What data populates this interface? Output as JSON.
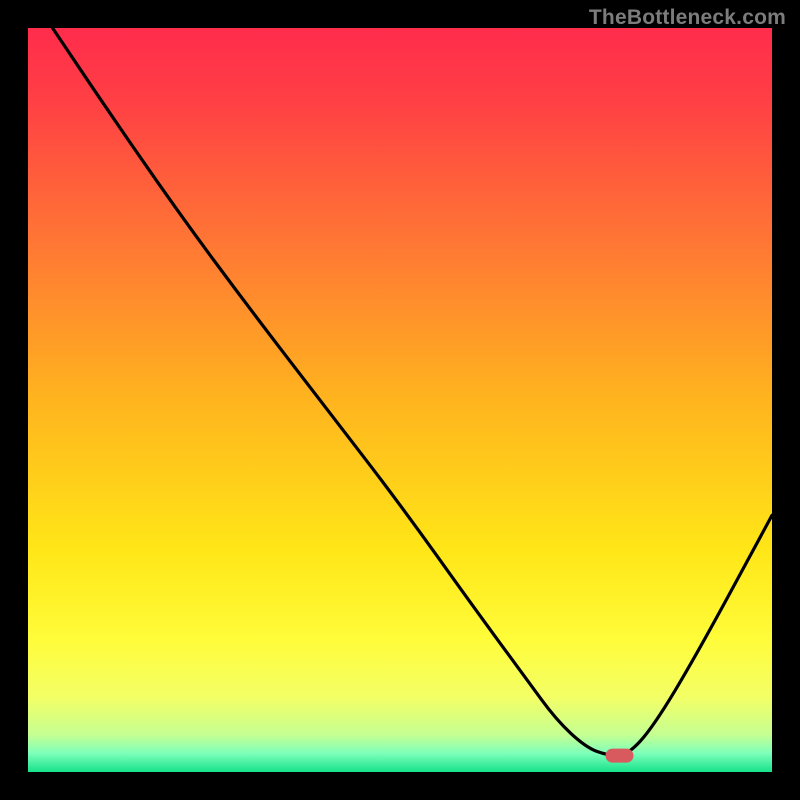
{
  "watermark": "TheBottleneck.com",
  "chart_data": {
    "type": "line",
    "title": "",
    "xlabel": "",
    "ylabel": "",
    "xlim": [
      0,
      100
    ],
    "ylim": [
      0,
      100
    ],
    "series": [
      {
        "name": "curve",
        "x": [
          3.3,
          10,
          20,
          30,
          40,
          50,
          60,
          67,
          71,
          75,
          78,
          80.5,
          84,
          90,
          100
        ],
        "y": [
          100,
          90,
          75.5,
          62,
          49,
          36,
          22,
          12.5,
          7,
          3.3,
          2.2,
          2.2,
          6,
          16,
          34.5
        ]
      }
    ],
    "marker": {
      "x": 79.5,
      "y": 2.2
    },
    "gradient_stops": [
      {
        "offset": 0.0,
        "color": "#ff2c4c"
      },
      {
        "offset": 0.1,
        "color": "#ff4044"
      },
      {
        "offset": 0.3,
        "color": "#ff7a33"
      },
      {
        "offset": 0.5,
        "color": "#ffb41e"
      },
      {
        "offset": 0.7,
        "color": "#ffe617"
      },
      {
        "offset": 0.82,
        "color": "#fffc39"
      },
      {
        "offset": 0.9,
        "color": "#f3ff66"
      },
      {
        "offset": 0.95,
        "color": "#c5ff92"
      },
      {
        "offset": 0.975,
        "color": "#7dffba"
      },
      {
        "offset": 1.0,
        "color": "#16e28a"
      }
    ]
  }
}
